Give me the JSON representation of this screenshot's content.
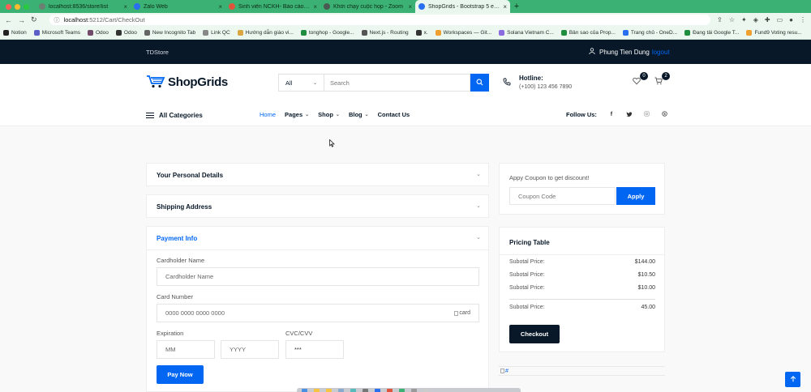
{
  "browser": {
    "tabs": [
      {
        "title": "localhost:8536/store/list",
        "active": false,
        "color": "#6b7f73"
      },
      {
        "title": "Zalo Web",
        "active": false,
        "color": "#2a6ff0"
      },
      {
        "title": "Sinh viên NCKH- Báo cáo tiến",
        "active": false,
        "color": "#e0543d"
      },
      {
        "title": "Khởi chạy cuộc họp - Zoom",
        "active": false,
        "color": "#4a5a52"
      },
      {
        "title": "ShopGrids - Bootstrap 5 eCom",
        "active": true,
        "color": "#2a6ff0"
      }
    ],
    "url_host": "localhost",
    "url_path": ":5212/Cart/CheckOut",
    "bookmarks": [
      {
        "label": "Notion",
        "color": "#222"
      },
      {
        "label": "Microsoft Teams",
        "color": "#5b5fc7"
      },
      {
        "label": "Odoo",
        "color": "#714b67"
      },
      {
        "label": "Odoo",
        "color": "#333"
      },
      {
        "label": "New Incognito Tab",
        "color": "#666"
      },
      {
        "label": "Link QC",
        "color": "#888"
      },
      {
        "label": "Hướng dẫn giáo vi...",
        "color": "#d9a640"
      },
      {
        "label": "tonghop - Google...",
        "color": "#1e8e3e"
      },
      {
        "label": "Next.js - Routing",
        "color": "#555"
      },
      {
        "label": "x.",
        "color": "#333"
      },
      {
        "label": "Workspaces — Git...",
        "color": "#f0a030"
      },
      {
        "label": "Solana Vietnam C...",
        "color": "#8a6be0"
      },
      {
        "label": "Bản sao của Prop...",
        "color": "#1e8e3e"
      },
      {
        "label": "Trang chủ - OneD...",
        "color": "#2a6ff0"
      },
      {
        "label": "Đang tải Google T...",
        "color": "#1e8e3e"
      },
      {
        "label": "Fund9 Voting resu...",
        "color": "#f0a030"
      }
    ]
  },
  "topbar": {
    "brand": "TDStore",
    "username": "Phung Tien Dung",
    "logout": "logout"
  },
  "header": {
    "logo_prefix": "Shop",
    "logo_suffix": "Grids",
    "search_category": "All",
    "search_placeholder": "Search",
    "hotline_label": "Hotline:",
    "hotline_number": "(+100) 123 456 7890",
    "wishlist_count": "0",
    "cart_count": "2",
    "all_categories": "All Categories",
    "menu": [
      {
        "label": "Home",
        "active": true,
        "dropdown": false
      },
      {
        "label": "Pages",
        "active": false,
        "dropdown": true
      },
      {
        "label": "Shop",
        "active": false,
        "dropdown": true
      },
      {
        "label": "Blog",
        "active": false,
        "dropdown": true
      },
      {
        "label": "Contact Us",
        "active": false,
        "dropdown": false
      }
    ],
    "follow_label": "Follow Us:",
    "social": [
      "f",
      "t",
      "ig",
      "sk"
    ]
  },
  "checkout": {
    "personal_details": "Your Personal Details",
    "shipping_address": "Shipping Address",
    "payment_info": "Payment Info",
    "cardholder_label": "Cardholder Name",
    "cardholder_placeholder": "Cardholder Name",
    "card_number_label": "Card Number",
    "card_number_placeholder": "0000 0000 0000 0000",
    "card_img_alt": "card",
    "expiration_label": "Expiration",
    "mm_placeholder": "MM",
    "yyyy_placeholder": "YYYY",
    "cvc_label": "CVC/CVV",
    "cvc_placeholder": "***",
    "pay_now": "Pay Now"
  },
  "coupon": {
    "title": "Appy Coupon to get discount!",
    "placeholder": "Coupon Code",
    "apply": "Apply"
  },
  "pricing": {
    "title": "Pricing Table",
    "rows": [
      {
        "label": "Subotal Price:",
        "value": "$144.00"
      },
      {
        "label": "Subotal Price:",
        "value": "$10.50"
      },
      {
        "label": "Subotal Price:",
        "value": "$10.00"
      }
    ],
    "total_label": "Subotal Price:",
    "total_value": "45.00",
    "checkout": "Checkout"
  },
  "broken_image_alt": "#",
  "colors": {
    "primary": "#0167f3",
    "dark": "#081828",
    "tabbar": "#3bb273"
  }
}
